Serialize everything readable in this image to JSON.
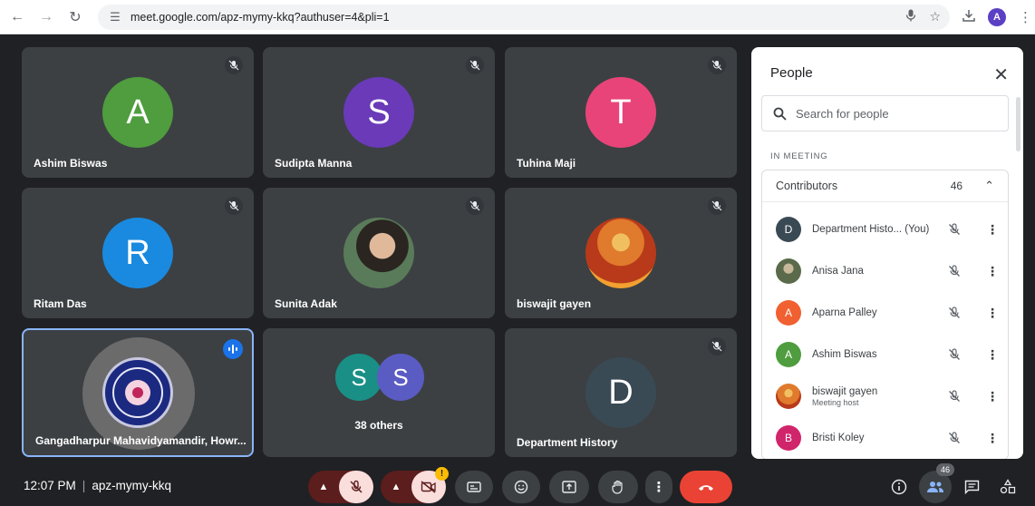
{
  "browser": {
    "url": "meet.google.com/apz-mymy-kkq?authuser=4&pli=1",
    "profile_initial": "A"
  },
  "tiles": [
    {
      "name": "Ashim Biswas",
      "initial": "A",
      "color": "#4f9d3e"
    },
    {
      "name": "Sudipta Manna",
      "initial": "S",
      "color": "#6a3ab8"
    },
    {
      "name": "Tuhina Maji",
      "initial": "T",
      "color": "#e8447a"
    },
    {
      "name": "Ritam Das",
      "initial": "R",
      "color": "#1a8ae0"
    },
    {
      "name": "Sunita Adak",
      "initial": "",
      "color": "#5a6b59"
    },
    {
      "name": "biswajit gayen",
      "initial": "",
      "color": "#e07a2c"
    },
    {
      "name": "Gangadharpur Mahavidyamandir, Howr...",
      "initial": "",
      "color": "#1b2a80"
    },
    {
      "name": "38 others",
      "initial": "",
      "color": ""
    },
    {
      "name": "Department History",
      "initial": "D",
      "color": "#3a4a55"
    }
  ],
  "others": {
    "avatar1": "S",
    "avatar2": "S",
    "color1": "#1a8f85",
    "color2": "#5b5bc4"
  },
  "panel": {
    "title": "People",
    "search_placeholder": "Search for people",
    "section_label": "IN MEETING",
    "contributors_label": "Contributors",
    "contributors_count": "46",
    "people": [
      {
        "name": "Department Histo... (You)",
        "initial": "D",
        "color": "#3a4a55",
        "sub": ""
      },
      {
        "name": "Anisa Jana",
        "initial": "",
        "color": "#7a8a6a",
        "sub": ""
      },
      {
        "name": "Aparna Palley",
        "initial": "A",
        "color": "#f06030",
        "sub": ""
      },
      {
        "name": "Ashim Biswas",
        "initial": "A",
        "color": "#4f9d3e",
        "sub": ""
      },
      {
        "name": "biswajit gayen",
        "initial": "",
        "color": "#e07a2c",
        "sub": "Meeting host"
      },
      {
        "name": "Bristi Koley",
        "initial": "B",
        "color": "#d0246b",
        "sub": ""
      }
    ]
  },
  "bottom": {
    "time": "12:07 PM",
    "meeting_code": "apz-mymy-kkq",
    "people_count": "46",
    "warning": "!"
  }
}
